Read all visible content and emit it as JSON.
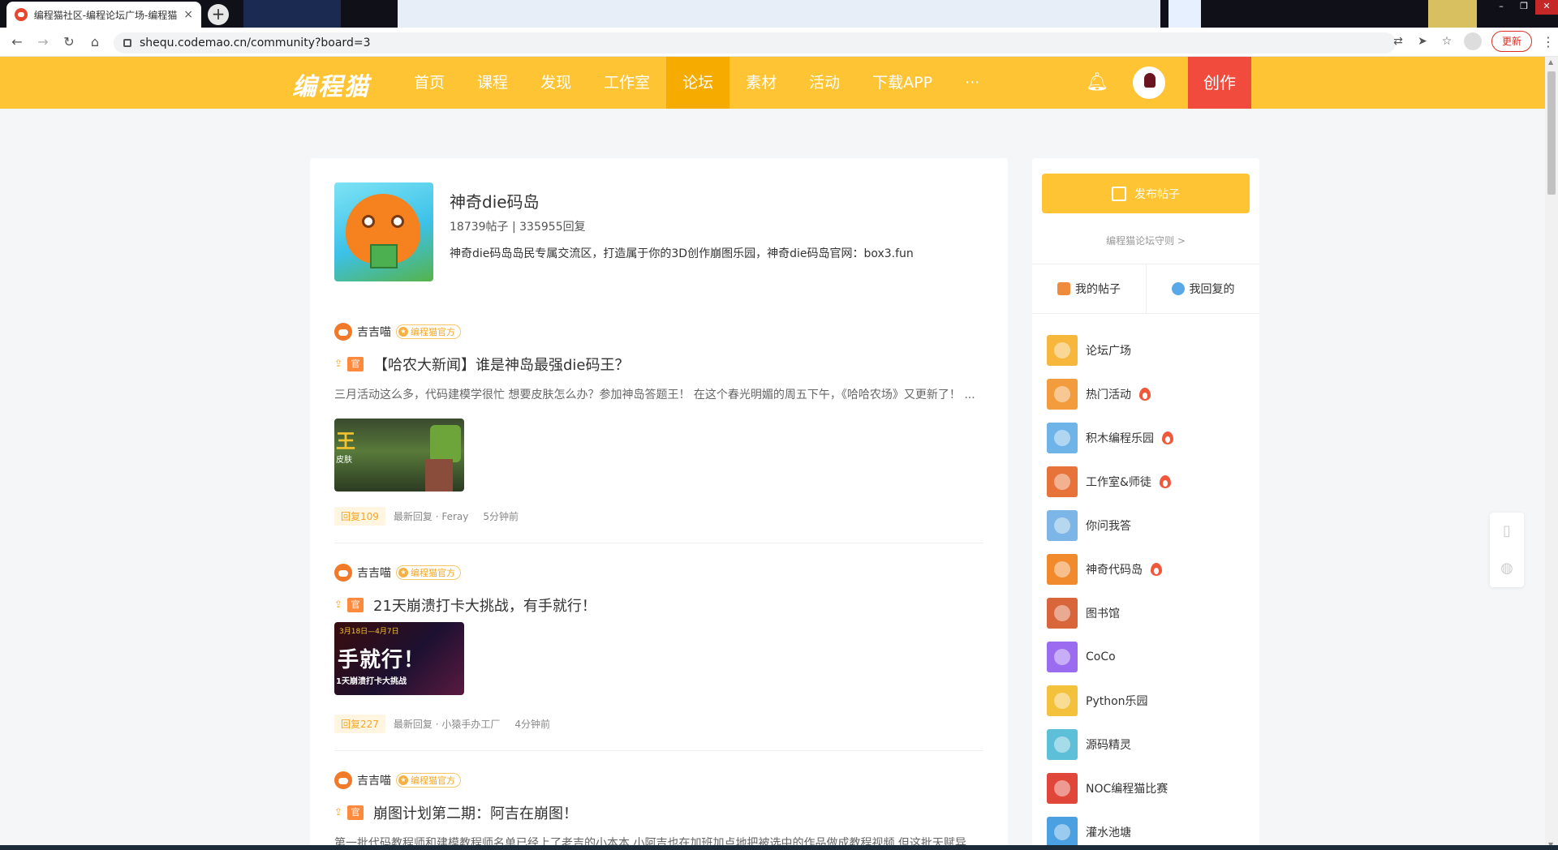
{
  "browser": {
    "tab_title": "编程猫社区-编程论坛广场-编程猫",
    "tab_close": "×",
    "new_tab": "+",
    "url": "shequ.codemao.cn/community?board=3",
    "update_label": "更新",
    "window_buttons": [
      "–",
      "❐",
      "✕"
    ]
  },
  "site": {
    "logo": "编程猫",
    "nav": [
      {
        "label": "首页",
        "active": false
      },
      {
        "label": "课程",
        "active": false
      },
      {
        "label": "发现",
        "active": false
      },
      {
        "label": "工作室",
        "active": false
      },
      {
        "label": "论坛",
        "active": true
      },
      {
        "label": "素材",
        "active": false
      },
      {
        "label": "活动",
        "active": false
      },
      {
        "label": "下载APP",
        "active": false
      },
      {
        "label": "···",
        "active": false
      }
    ],
    "create_label": "创作",
    "brand_color": "#fec433",
    "create_color": "#f04b3c"
  },
  "board": {
    "name": "神奇die码岛",
    "stats": "18739帖子 | 335955回复",
    "description": "神奇die码岛岛民专属交流区，打造属于你的3D创作崩图乐园，神奇die码岛官网：box3.fun"
  },
  "posts": [
    {
      "author": "吉吉喵",
      "badge": "编程猫官方",
      "tag": "官",
      "title": "【哈农大新闻】谁是神岛最强die码王？",
      "excerpt": "三月活动这么多，代码建模学很忙 想要皮肤怎么办？参加神岛答题王！ 在这个春光明媚的周五下午，《哈哈农场》又更新了！ ...",
      "thumb_text": "王",
      "thumb_sub": "皮肤",
      "replies": "回复109",
      "last_reply": "最新回复 · Feray",
      "time": "5分钟前"
    },
    {
      "author": "吉吉喵",
      "badge": "编程猫官方",
      "tag": "官",
      "title": "21天崩溃打卡大挑战，有手就行！",
      "excerpt": "",
      "thumb_top": "3月18日—4月7日",
      "thumb_text": "手就行！",
      "thumb_sub": "1天崩溃打卡大挑战",
      "replies": "回复227",
      "last_reply": "最新回复 · 小猿手办工厂",
      "time": "4分钟前"
    },
    {
      "author": "吉吉喵",
      "badge": "编程猫官方",
      "tag": "官",
      "title": "崩图计划第二期：阿吉在崩图！",
      "excerpt": "第一批代码教程师和建模教程师名单已经上了老吉的小本本 小阿吉也在加班加点地把被选中的作品做成教程视频 但这批天赋异"
    }
  ],
  "sidebar": {
    "publish_label": "发布帖子",
    "rules_link": "编程猫论坛守则 >",
    "tabs": [
      {
        "label": "我的帖子"
      },
      {
        "label": "我回复的"
      }
    ],
    "boards": [
      {
        "name": "论坛广场",
        "hot": false,
        "color": "#f6b73c"
      },
      {
        "name": "热门活动",
        "hot": true,
        "color": "#f39c3d"
      },
      {
        "name": "积木编程乐园",
        "hot": true,
        "color": "#6fb4e8"
      },
      {
        "name": "工作室&师徒",
        "hot": true,
        "color": "#e8733a"
      },
      {
        "name": "你问我答",
        "hot": false,
        "color": "#7cb6e6"
      },
      {
        "name": "神奇代码岛",
        "hot": true,
        "color": "#f08a2c"
      },
      {
        "name": "图书馆",
        "hot": false,
        "color": "#d9653a"
      },
      {
        "name": "CoCo",
        "hot": false,
        "color": "#9b6cf0"
      },
      {
        "name": "Python乐园",
        "hot": false,
        "color": "#f4c13c"
      },
      {
        "name": "源码精灵",
        "hot": false,
        "color": "#5ec0d8"
      },
      {
        "name": "NOC编程猫比赛",
        "hot": false,
        "color": "#e0463a"
      },
      {
        "name": "灌水池塘",
        "hot": false,
        "color": "#4aa0e0"
      }
    ]
  }
}
